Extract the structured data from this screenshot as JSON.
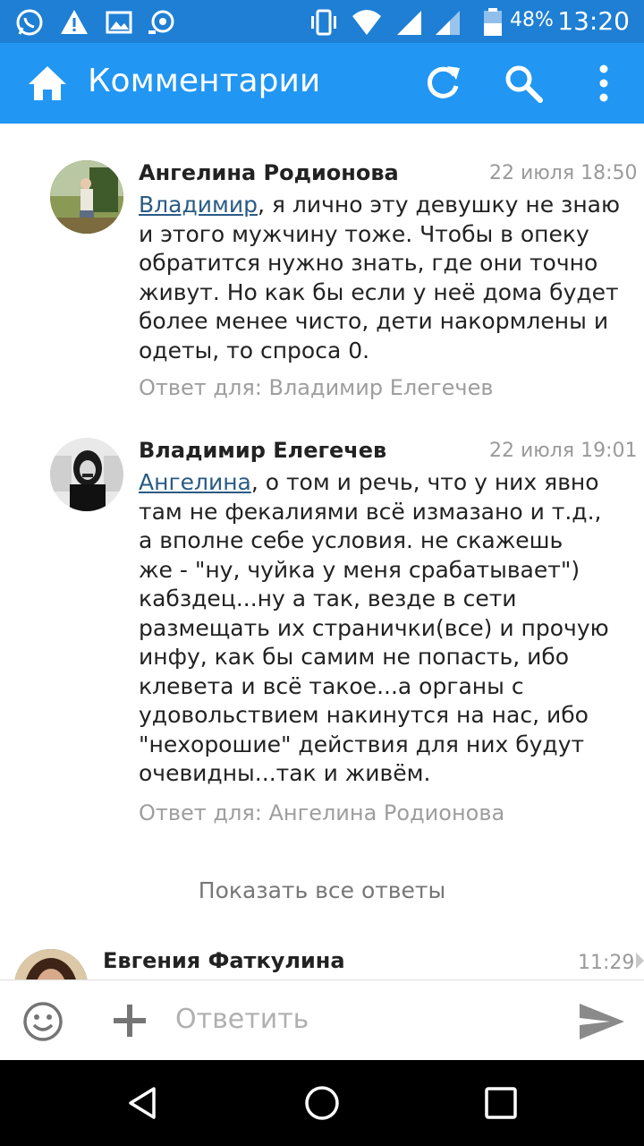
{
  "status_bar": {
    "battery_percent": "48%",
    "time": "13:20",
    "icons": [
      "whatsapp-icon",
      "warning-icon",
      "image-icon",
      "camera-icon",
      "vibrate-icon",
      "wifi-icon",
      "signal-icon",
      "battery-icon"
    ]
  },
  "toolbar": {
    "title": "Комментарии",
    "icons": [
      "home-icon",
      "refresh-icon",
      "search-icon",
      "more-vert-icon"
    ]
  },
  "comments": [
    {
      "author": "Ангелина Родионова",
      "date": "22 июля 18:50",
      "mention": "Владимир",
      "lines": [
        ", я лично эту девушку не знаю",
        "и этого мужчину тоже. Чтобы в опеку",
        "обратится нужно знать, где они точно",
        "живут. Но как бы если у неё дома будет",
        "более менее чисто, дети накормлены и",
        "одеты, то спроса 0."
      ],
      "reply_to": "Ответ для: Владимир Елегечев"
    },
    {
      "author": "Владимир Елегечев",
      "date": "22 июля 19:01",
      "mention": "Ангелина",
      "lines": [
        ", о том и речь, что у них явно",
        "там не фекалиями всё измазано и т.д.,",
        "а вполне себе условия. не скажешь",
        "же - \"ну, чуйка у меня срабатывает\")",
        "кабздец...ну а так, везде в сети",
        "размещать их странички(все) и прочую",
        "инфу, как бы самим не попасть, ибо",
        "клевета и всё такое...а органы с",
        "удовольствием накинутся на нас, ибо",
        "\"нехорошие\" действия для них будут",
        "очевидны...так и живём."
      ],
      "reply_to": "Ответ для: Ангелина Родионова"
    }
  ],
  "show_all_replies": "Показать все ответы",
  "next_comment": {
    "author": "Евгения Фаткулина",
    "time": "11:29"
  },
  "compose": {
    "placeholder": "Ответить"
  },
  "colors": {
    "status_bar": "#1e7fd4",
    "toolbar": "#2196f3",
    "mention": "#2a5b85"
  }
}
